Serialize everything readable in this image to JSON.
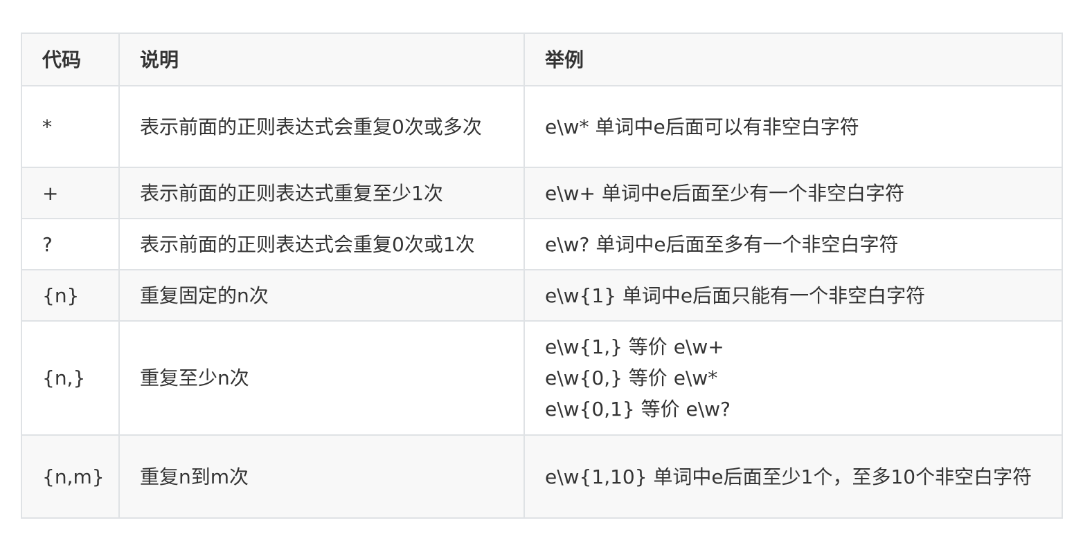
{
  "table": {
    "headers": [
      "代码",
      "说明",
      "举例"
    ],
    "rows": [
      {
        "code": "*",
        "desc": "表示前面的正则表达式会重复0次或多次",
        "example": [
          "e\\w* 单词中e后面可以有非空白字符"
        ]
      },
      {
        "code": "+",
        "desc": "表示前面的正则表达式重复至少1次",
        "example": [
          "e\\w+ 单词中e后面至少有一个非空白字符"
        ]
      },
      {
        "code": "?",
        "desc": "表示前面的正则表达式会重复0次或1次",
        "example": [
          "e\\w? 单词中e后面至多有一个非空白字符"
        ]
      },
      {
        "code": "{n}",
        "desc": "重复固定的n次",
        "example": [
          "e\\w{1} 单词中e后面只能有一个非空白字符"
        ]
      },
      {
        "code": "{n,}",
        "desc": "重复至少n次",
        "example": [
          "e\\w{1,} 等价 e\\w+",
          "e\\w{0,} 等价 e\\w*",
          "e\\w{0,1} 等价 e\\w?"
        ]
      },
      {
        "code": "{n,m}",
        "desc": "重复n到m次",
        "example": [
          "e\\w{1,10} 单词中e后面至少1个，至多10个非空白字符"
        ]
      }
    ]
  }
}
